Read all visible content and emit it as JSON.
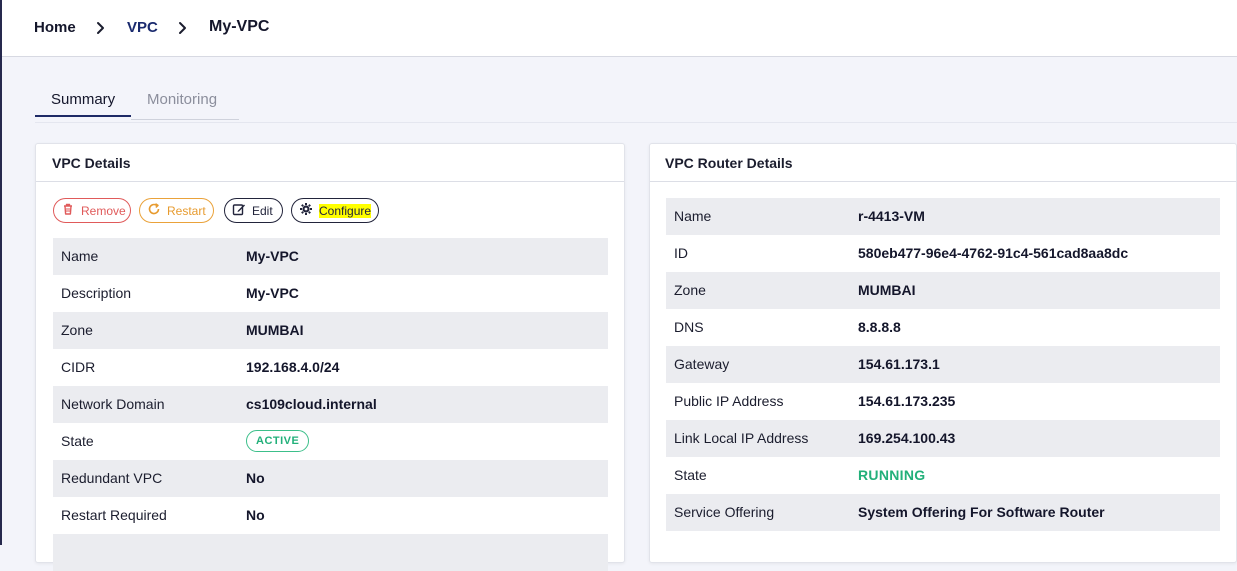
{
  "breadcrumb": {
    "home": "Home",
    "vpc": "VPC",
    "current": "My-VPC"
  },
  "tabs": {
    "summary": "Summary",
    "monitoring": "Monitoring"
  },
  "vpc_details": {
    "title": "VPC Details",
    "buttons": {
      "remove": "Remove",
      "restart": "Restart",
      "edit": "Edit",
      "configure": "Configure"
    },
    "rows": [
      {
        "label": "Name",
        "value": "My-VPC"
      },
      {
        "label": "Description",
        "value": "My-VPC"
      },
      {
        "label": "Zone",
        "value": "MUMBAI"
      },
      {
        "label": "CIDR",
        "value": "192.168.4.0/24"
      },
      {
        "label": "Network Domain",
        "value": "cs109cloud.internal"
      },
      {
        "label": "State",
        "value": "ACTIVE"
      },
      {
        "label": "Redundant VPC",
        "value": "No"
      },
      {
        "label": "Restart Required",
        "value": "No"
      }
    ]
  },
  "router_details": {
    "title": "VPC Router Details",
    "rows": [
      {
        "label": "Name",
        "value": "r-4413-VM"
      },
      {
        "label": "ID",
        "value": "580eb477-96e4-4762-91c4-561cad8aa8dc"
      },
      {
        "label": "Zone",
        "value": "MUMBAI"
      },
      {
        "label": "DNS",
        "value": "8.8.8.8"
      },
      {
        "label": "Gateway",
        "value": "154.61.173.1"
      },
      {
        "label": "Public IP Address",
        "value": "154.61.173.235"
      },
      {
        "label": "Link Local IP Address",
        "value": "169.254.100.43"
      },
      {
        "label": "State",
        "value": "RUNNING"
      },
      {
        "label": "Service Offering",
        "value": "System Offering For Software Router"
      }
    ]
  },
  "colors": {
    "remove": "#e05a5a",
    "restart": "#e79b2f",
    "active": "#22b07a",
    "running": "#22b07a",
    "highlight": "#ffff00",
    "tab_underline": "#1e2a66"
  },
  "icons": {
    "separator": "chevron-right-icon",
    "remove": "trash-icon",
    "restart": "refresh-icon",
    "edit": "edit-icon",
    "configure": "gear-icon"
  }
}
